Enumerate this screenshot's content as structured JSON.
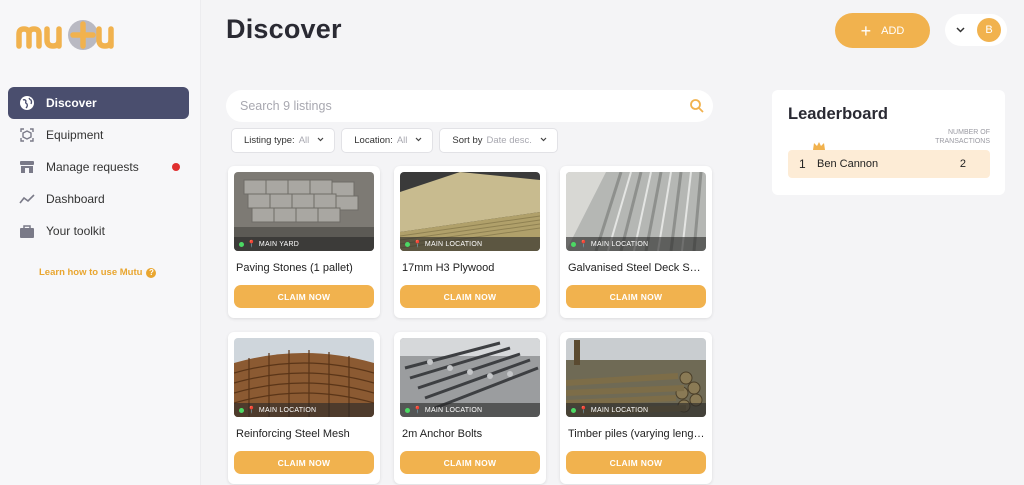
{
  "brand": {
    "name": "mutu",
    "color": "#f1b24e"
  },
  "sidebar": {
    "items": [
      {
        "label": "Discover",
        "icon": "globe-icon",
        "active": true
      },
      {
        "label": "Equipment",
        "icon": "equipment-icon"
      },
      {
        "label": "Manage requests",
        "icon": "store-icon",
        "badge": "red-dot"
      },
      {
        "label": "Dashboard",
        "icon": "trend-icon"
      },
      {
        "label": "Your toolkit",
        "icon": "briefcase-icon"
      }
    ],
    "learn_link": "Learn how to use Mutu"
  },
  "header": {
    "title": "Discover",
    "add_label": "ADD",
    "user_initial": "B"
  },
  "search": {
    "placeholder": "Search 9 listings",
    "value": ""
  },
  "filters": [
    {
      "label": "Listing type:",
      "value": "All"
    },
    {
      "label": "Location:",
      "value": "All"
    },
    {
      "label": "Sort by",
      "value": "Date desc."
    }
  ],
  "listings": [
    {
      "title": "Paving Stones (1 pallet)",
      "location": "MAIN YARD",
      "action": "CLAIM NOW"
    },
    {
      "title": "17mm H3 Plywood",
      "location": "MAIN LOCATION",
      "action": "CLAIM NOW"
    },
    {
      "title": "Galvanised Steel Deck Sheets",
      "location": "MAIN LOCATION",
      "action": "CLAIM NOW"
    },
    {
      "title": "Reinforcing Steel Mesh",
      "location": "MAIN LOCATION",
      "action": "CLAIM NOW"
    },
    {
      "title": "2m Anchor Bolts",
      "location": "MAIN LOCATION",
      "action": "CLAIM NOW"
    },
    {
      "title": "Timber piles (varying lengths)",
      "location": "MAIN LOCATION",
      "action": "CLAIM NOW"
    }
  ],
  "leaderboard": {
    "title": "Leaderboard",
    "column_header_line1": "NUMBER OF",
    "column_header_line2": "TRANSACTIONS",
    "rows": [
      {
        "rank": "1",
        "name": "Ben Cannon",
        "count": "2"
      }
    ]
  }
}
